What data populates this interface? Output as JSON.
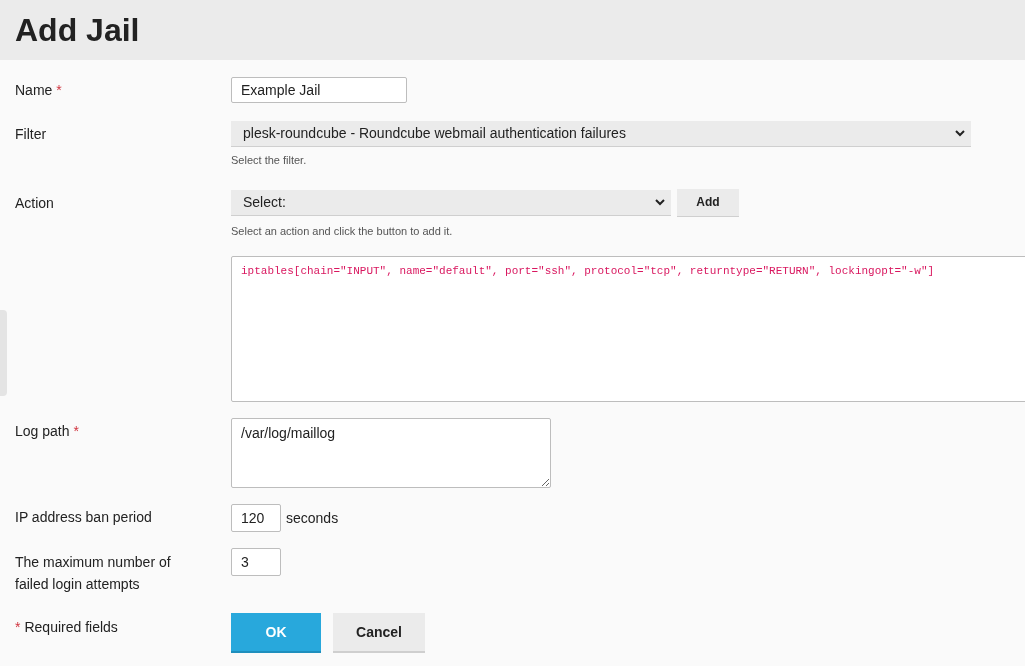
{
  "page": {
    "title": "Add Jail"
  },
  "form": {
    "name": {
      "label": "Name",
      "required": true,
      "value": "Example Jail"
    },
    "filter": {
      "label": "Filter",
      "required": false,
      "value": "plesk-roundcube - Roundcube webmail authentication failures",
      "hint": "Select the filter."
    },
    "action": {
      "label": "Action",
      "required": false,
      "value": "Select:",
      "hint": "Select an action and click the button to add it.",
      "add_button": "Add",
      "actions_text": "iptables[chain=\"INPUT\", name=\"default\", port=\"ssh\", protocol=\"tcp\", returntype=\"RETURN\", lockingopt=\"-w\"]"
    },
    "log_path": {
      "label": "Log path",
      "required": true,
      "value": "/var/log/maillog"
    },
    "ban_period": {
      "label": "IP address ban period",
      "required": false,
      "value": "120",
      "unit": "seconds"
    },
    "max_retry": {
      "label": "The maximum number of failed login attempts",
      "required": false,
      "value": "3"
    }
  },
  "footer": {
    "required_note": "Required fields",
    "required_mark": "*",
    "buttons": [
      {
        "label": "OK",
        "kind": "primary"
      },
      {
        "label": "Cancel",
        "kind": "secondary"
      }
    ]
  }
}
